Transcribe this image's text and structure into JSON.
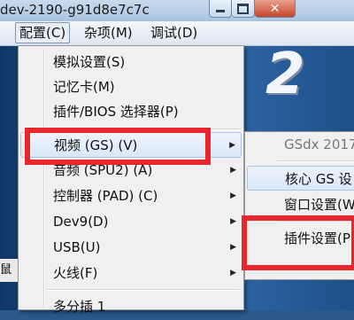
{
  "window": {
    "title": "dev-2190-g91d8e7c7c"
  },
  "menubar": {
    "items": [
      {
        "label": "配置(C)"
      },
      {
        "label": "杂项(M)"
      },
      {
        "label": "调试(D)"
      }
    ]
  },
  "config_menu": {
    "items": [
      {
        "label": "模拟设置(S)"
      },
      {
        "label": "记忆卡(M)"
      },
      {
        "label": "插件/BIOS 选择器(P)"
      },
      {
        "label": "视频 (GS) (V)"
      },
      {
        "label": "音频 (SPU2) (A)"
      },
      {
        "label": "控制器 (PAD) (C)"
      },
      {
        "label": "Dev9(D)"
      },
      {
        "label": "USB(U)"
      },
      {
        "label": "火线(F)"
      },
      {
        "label": "多分插 1"
      }
    ]
  },
  "gs_submenu": {
    "items": [
      {
        "label": "GSdx 2017"
      },
      {
        "label": "核心 GS 设"
      },
      {
        "label": "窗口设置(W"
      },
      {
        "label": "插件设置(P)"
      }
    ]
  },
  "background": {
    "bottom_label": "鼠拟"
  },
  "colors": {
    "annotation_red": "#e8262b",
    "menu_highlight": "#d9e7f8"
  }
}
